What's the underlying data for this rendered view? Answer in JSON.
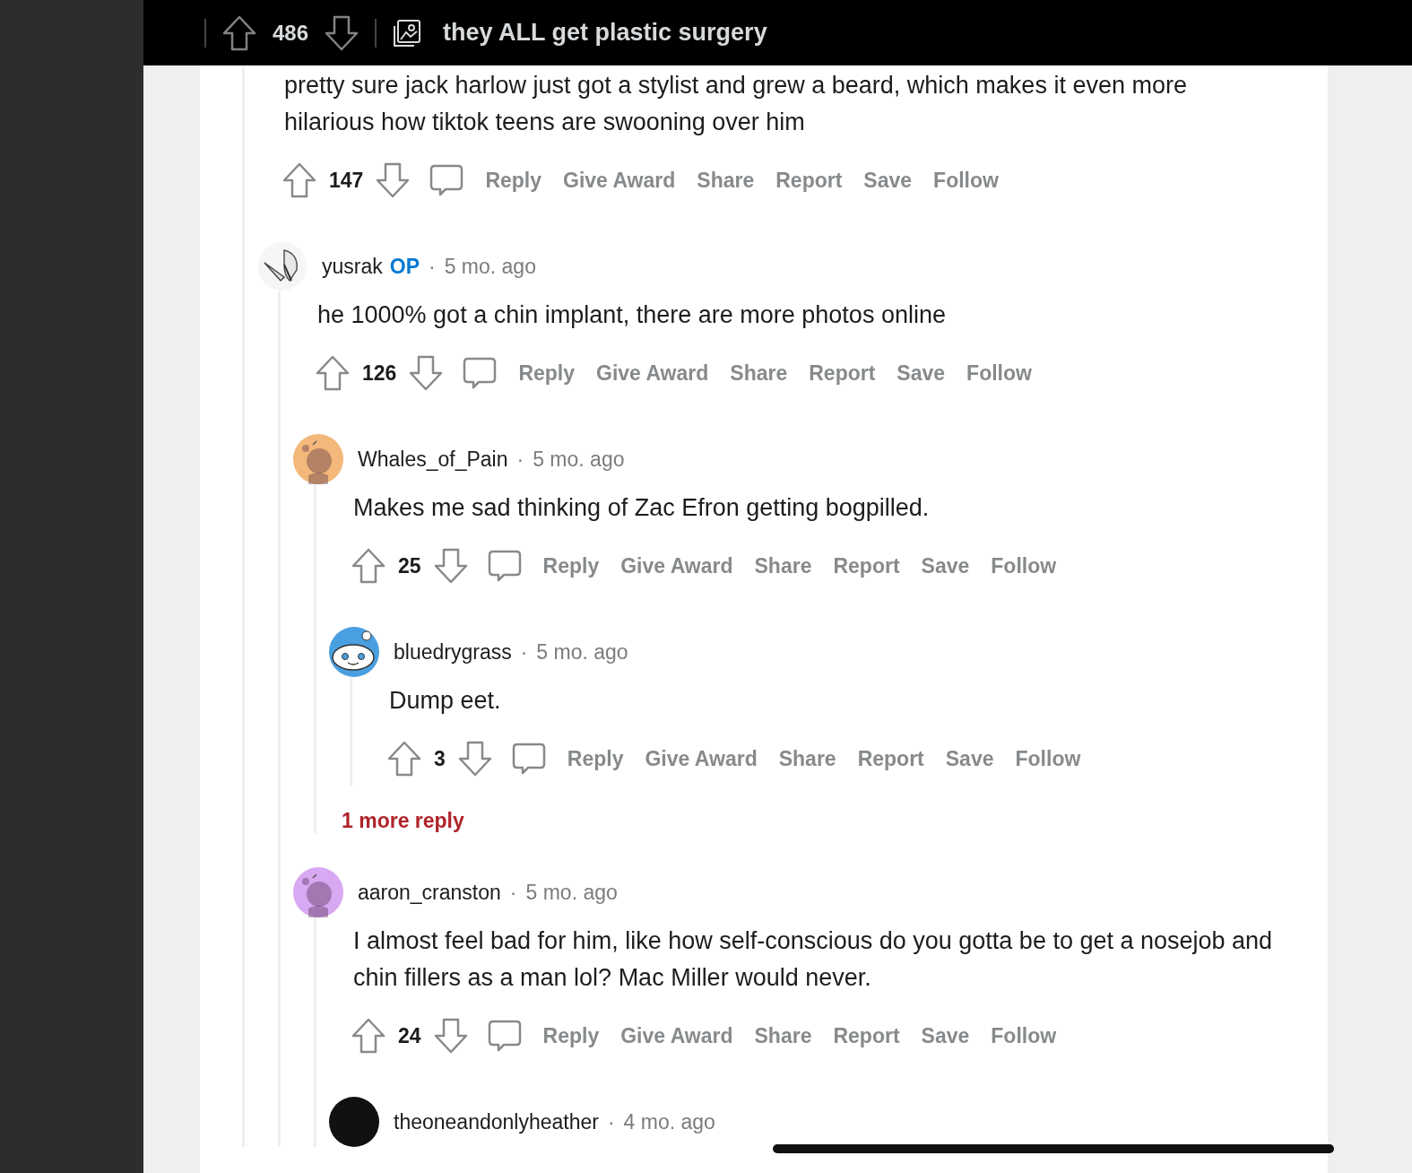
{
  "top_bar": {
    "votes": "486",
    "title": "they ALL get plastic surgery"
  },
  "comments": [
    {
      "text": "pretty sure jack harlow just got a stylist and grew a beard, which makes it even more hilarious how tiktok teens are swooning over him",
      "votes": "147",
      "actions": [
        "Reply",
        "Give Award",
        "Share",
        "Report",
        "Save",
        "Follow"
      ],
      "children": [
        {
          "author": "yusrak",
          "op_badge": "OP",
          "separator": "·",
          "time": "5 mo. ago",
          "avatar": {
            "kind": "butterfly"
          },
          "text": "he 1000% got a chin implant, there are more photos online",
          "votes": "126",
          "actions": [
            "Reply",
            "Give Award",
            "Share",
            "Report",
            "Save",
            "Follow"
          ],
          "children": [
            {
              "author": "Whales_of_Pain",
              "separator": "·",
              "time": "5 mo. ago",
              "avatar": {
                "kind": "snoo",
                "color": "#f4b87a"
              },
              "text": "Makes me sad thinking of Zac Efron getting bogpilled.",
              "votes": "25",
              "actions": [
                "Reply",
                "Give Award",
                "Share",
                "Report",
                "Save",
                "Follow"
              ],
              "children": [
                {
                  "author": "bluedrygrass",
                  "separator": "·",
                  "time": "5 mo. ago",
                  "avatar": {
                    "kind": "face",
                    "color": "#4a9fe0"
                  },
                  "text": "Dump eet.",
                  "votes": "3",
                  "actions": [
                    "Reply",
                    "Give Award",
                    "Share",
                    "Report",
                    "Save",
                    "Follow"
                  ],
                  "more_replies": "1 more reply"
                }
              ]
            },
            {
              "author": "aaron_cranston",
              "separator": "·",
              "time": "5 mo. ago",
              "avatar": {
                "kind": "snoo",
                "color": "#d9a8f2"
              },
              "text": "I almost feel bad for him, like how self-conscious do you gotta be to get a nosejob and chin fillers as a man lol? Mac Miller would never.",
              "votes": "24",
              "actions": [
                "Reply",
                "Give Award",
                "Share",
                "Report",
                "Save",
                "Follow"
              ],
              "children": [
                {
                  "author": "theoneandonlyheather",
                  "separator": "·",
                  "time": "4 mo. ago",
                  "avatar": {
                    "kind": "plain",
                    "color": "#111111"
                  }
                }
              ]
            }
          ]
        }
      ]
    }
  ]
}
